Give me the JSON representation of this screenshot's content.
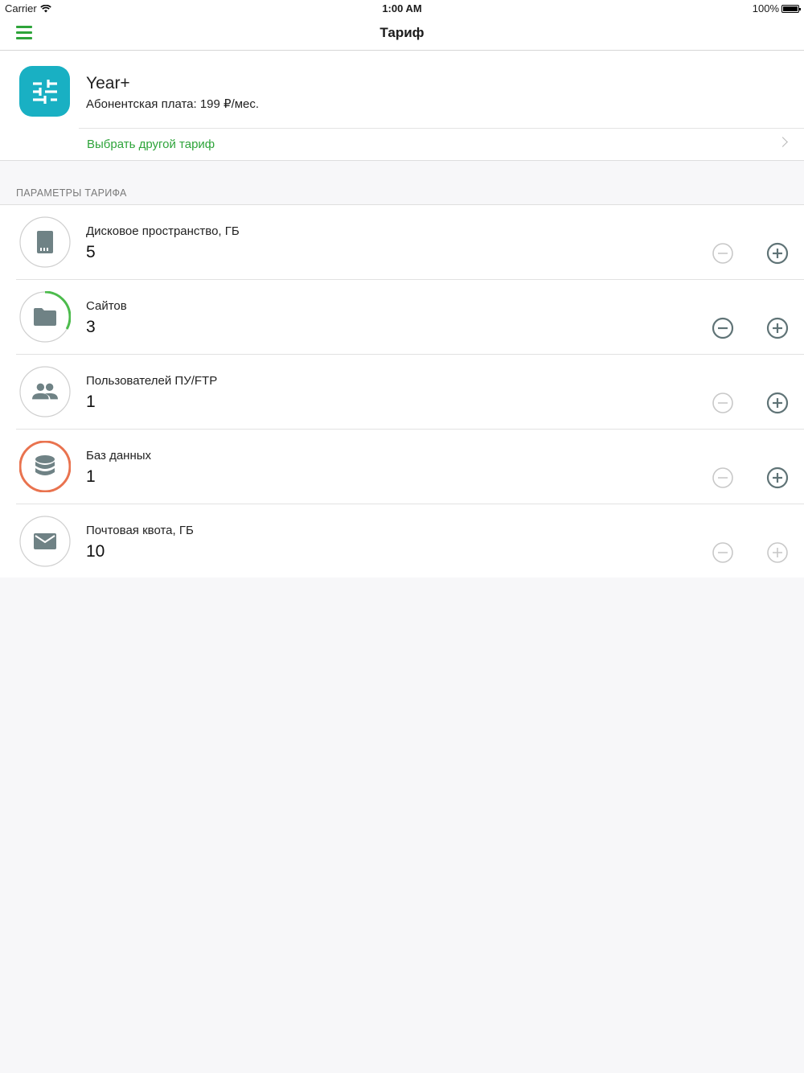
{
  "status_bar": {
    "carrier": "Carrier",
    "time": "1:00 AM",
    "battery": "100%"
  },
  "nav": {
    "title": "Тариф",
    "menu_icon": "hamburger-menu-icon",
    "accent_color": "#2ea43a"
  },
  "plan": {
    "name": "Year+",
    "fee": "Абонентская плата: 199 ₽/мес.",
    "change_label": "Выбрать другой тариф",
    "icon": "sliders-icon",
    "icon_color": "#19b0c3"
  },
  "params_section": {
    "header": "ПАРАМЕТРЫ ТАРИФА",
    "items": [
      {
        "label": "Дисковое пространство, ГБ",
        "value": "5",
        "icon": "storage-icon",
        "usage_fraction": 0,
        "ring_color": "#cfcfcf",
        "minus_enabled": false,
        "plus_enabled": true
      },
      {
        "label": "Сайтов",
        "value": "3",
        "icon": "folder-icon",
        "usage_fraction": 0.33,
        "ring_color": "#cfcfcf",
        "progress_color": "#4cbb4c",
        "minus_enabled": true,
        "plus_enabled": true
      },
      {
        "label": "Пользователей ПУ/FTP",
        "value": "1",
        "icon": "users-icon",
        "usage_fraction": 0,
        "ring_color": "#cfcfcf",
        "minus_enabled": false,
        "plus_enabled": true
      },
      {
        "label": "Баз данных",
        "value": "1",
        "icon": "database-icon",
        "usage_fraction": 1,
        "ring_color": "#e9734f",
        "minus_enabled": false,
        "plus_enabled": true
      },
      {
        "label": "Почтовая квота, ГБ",
        "value": "10",
        "icon": "mail-icon",
        "usage_fraction": 0,
        "ring_color": "#cfcfcf",
        "minus_enabled": false,
        "plus_enabled": false
      }
    ]
  }
}
